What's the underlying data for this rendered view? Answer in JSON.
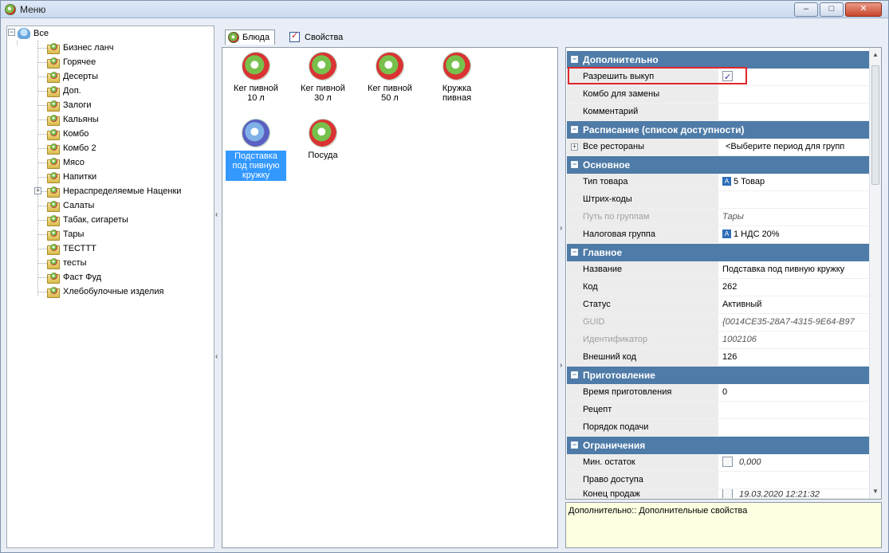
{
  "window": {
    "title": "Меню"
  },
  "tree": {
    "root": "Все",
    "items": [
      {
        "label": "Бизнес ланч"
      },
      {
        "label": "Горячее"
      },
      {
        "label": "Десерты"
      },
      {
        "label": "Доп."
      },
      {
        "label": "Залоги"
      },
      {
        "label": "Кальяны"
      },
      {
        "label": "Комбо"
      },
      {
        "label": "Комбо 2"
      },
      {
        "label": "Мясо"
      },
      {
        "label": "Напитки"
      },
      {
        "label": "Нераспределяемые Наценки",
        "expandable": true
      },
      {
        "label": "Салаты"
      },
      {
        "label": "Табак, сигареты"
      },
      {
        "label": "Тары"
      },
      {
        "label": "ТЕСТТТ"
      },
      {
        "label": "тесты"
      },
      {
        "label": "Фаст Фуд"
      },
      {
        "label": "Хлебобулочные изделия"
      }
    ]
  },
  "tabs": [
    {
      "label": "Блюда",
      "icon": "dish-icon",
      "active": true
    },
    {
      "label": "Свойства",
      "icon": "properties-icon",
      "active": false
    }
  ],
  "dishes": [
    {
      "label_line1": "Кег пивной",
      "label_line2": "10 л"
    },
    {
      "label_line1": "Кег пивной",
      "label_line2": "30 л"
    },
    {
      "label_line1": "Кег пивной",
      "label_line2": "50 л"
    },
    {
      "label_line1": "Кружка",
      "label_line2": "пивная"
    },
    {
      "label_line1": "Подставка",
      "label_line2": "под пивную",
      "label_line3": "кружку",
      "selected": true
    },
    {
      "label_line1": "Посуда",
      "label_line2": ""
    }
  ],
  "properties": {
    "cat_additional": "Дополнительно",
    "allow_buyout": "Разрешить выкуп",
    "combo_replace": "Комбо для замены",
    "comment": "Комментарий",
    "cat_schedule": "Расписание (список доступности)",
    "all_restaurants": "Все рестораны",
    "all_restaurants_value": "<Выберите период для групп",
    "cat_main": "Основное",
    "product_type": "Тип товара",
    "product_type_value": "5 Товар",
    "barcodes": "Штрих-коды",
    "group_path": "Путь по группам",
    "group_path_value": "Тары",
    "tax_group": "Налоговая группа",
    "tax_group_value": "1 НДС 20%",
    "cat_general": "Главное",
    "name": "Название",
    "name_value": "Подставка под пивную кружку",
    "code": "Код",
    "code_value": "262",
    "status": "Статус",
    "status_value": "Активный",
    "guid": "GUID",
    "guid_value": "{0014CE35-28A7-4315-9E64-B97",
    "identifier": "Идентификатор",
    "identifier_value": "1002106",
    "external_code": "Внешний код",
    "external_code_value": "126",
    "cat_cooking": "Приготовление",
    "cook_time": "Время приготовления",
    "cook_time_value": "0",
    "recipe": "Рецепт",
    "serving_order": "Порядок подачи",
    "cat_limits": "Ограничения",
    "min_stock": "Мин. остаток",
    "min_stock_value": "0,000",
    "access_right": "Право доступа",
    "sales_end": "Конец продаж",
    "sales_end_value": "19.03.2020 12:21:32"
  },
  "description": "Дополнительно:: Дополнительные свойства",
  "colors": {
    "category_header": "#4e7ba7",
    "selection": "#3399ff",
    "highlight": "#e0272b",
    "description_bg": "#ffffe1"
  }
}
